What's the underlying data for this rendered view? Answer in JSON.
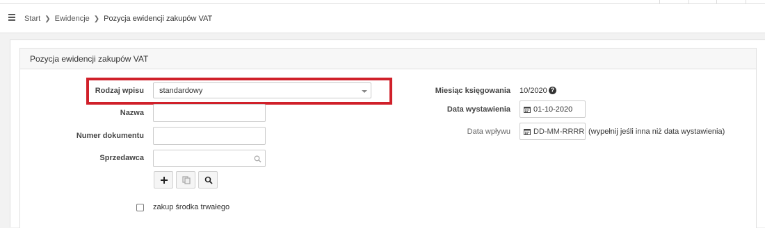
{
  "breadcrumb": {
    "items": [
      "Start",
      "Ewidencje",
      "Pozycja ewidencji zakupów VAT"
    ]
  },
  "panel": {
    "title": "Pozycja ewidencji zakupów VAT"
  },
  "form": {
    "entry_type": {
      "label": "Rodzaj wpisu",
      "value": "standardowy"
    },
    "name": {
      "label": "Nazwa",
      "value": ""
    },
    "document_number": {
      "label": "Numer dokumentu",
      "value": ""
    },
    "seller": {
      "label": "Sprzedawca",
      "value": ""
    },
    "fixed_asset_checkbox": {
      "label": "zakup środka trwałego",
      "checked": false
    },
    "buttons": {
      "add": "plus-icon",
      "copy": "copy-icon",
      "search": "search-icon"
    }
  },
  "right": {
    "booking_month": {
      "label": "Miesiąc księgowania",
      "value": "10/2020"
    },
    "issue_date": {
      "label": "Data wystawienia",
      "value": "01-10-2020"
    },
    "receipt_date": {
      "label": "Data wpływu",
      "placeholder": "DD-MM-RRRR",
      "hint": "(wypełnij jeśli inna niż data wystawienia)"
    }
  },
  "colors": {
    "highlight": "#d0202a",
    "panel_header_bg": "#f7f7f7"
  }
}
